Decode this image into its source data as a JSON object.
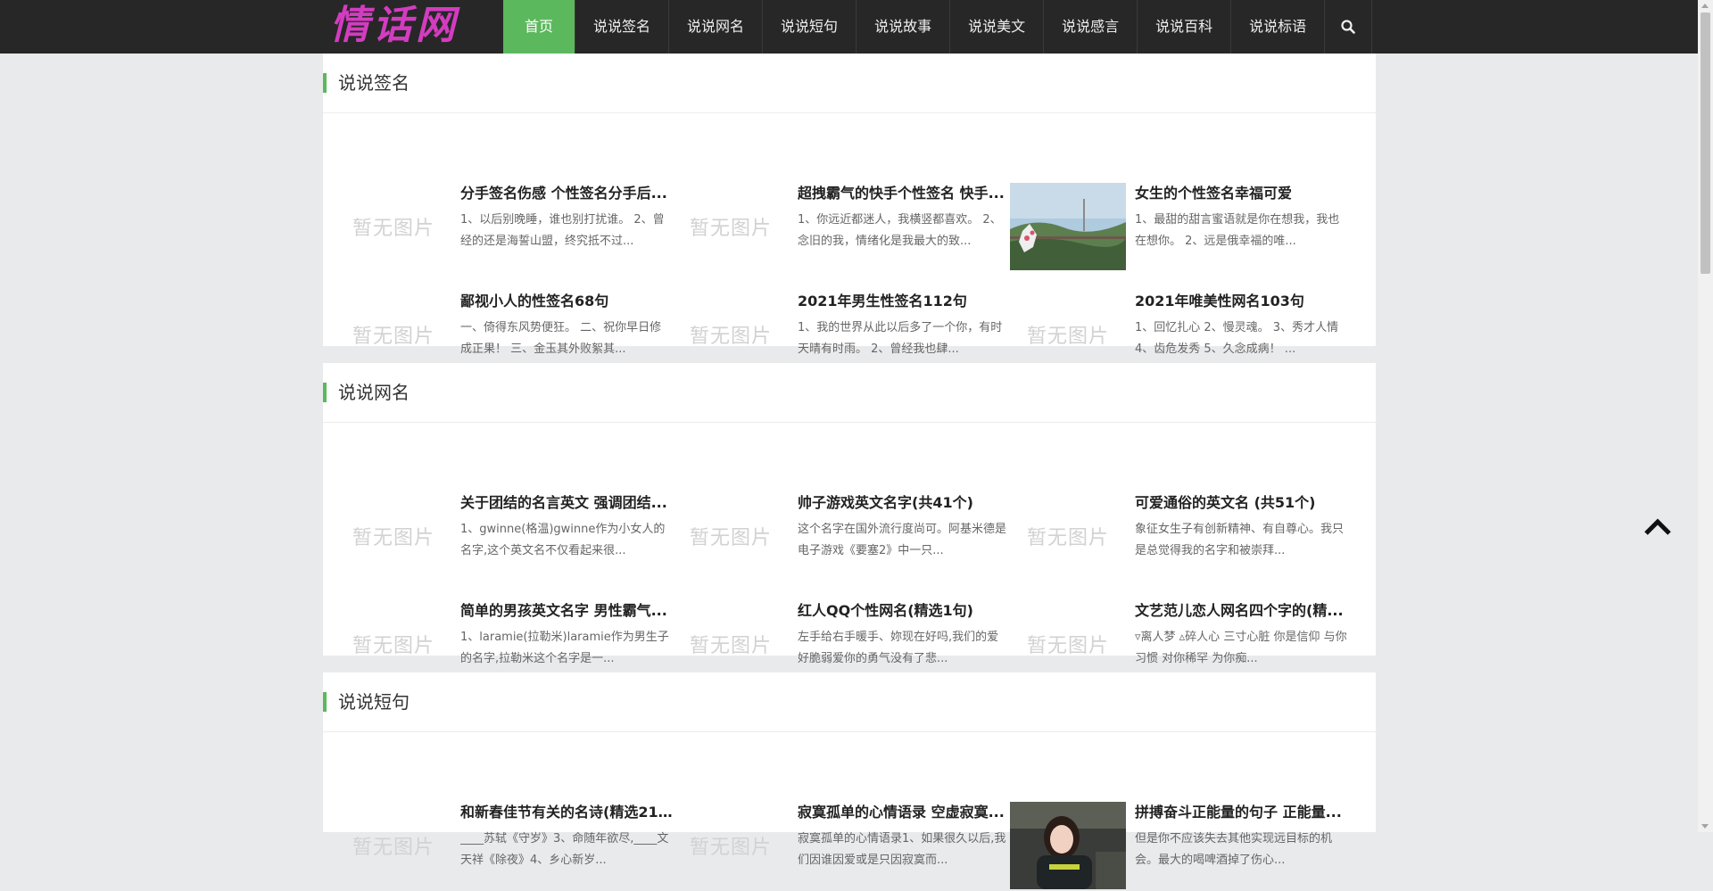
{
  "brand": {
    "logo_text": "情话网",
    "logo_color": "#d33cc0",
    "accent": "#5cb85c"
  },
  "nav": {
    "items": [
      "首页",
      "说说签名",
      "说说网名",
      "说说短句",
      "说说故事",
      "说说美文",
      "说说感言",
      "说说百科",
      "说说标语"
    ],
    "active_index": 0,
    "search_icon": "search-icon"
  },
  "placeholder_text": "暂无图片",
  "sections": [
    {
      "title": "说说签名",
      "cards": [
        {
          "title": "分手签名伤感 个性签名分手后...",
          "excerpt": "1、以后别晚睡，谁也别打扰谁。 2、曾经的还是海誓山盟，终究抵不过...",
          "image": "placeholder"
        },
        {
          "title": "超拽霸气的快手个性签名 快手...",
          "excerpt": "1、你远近都迷人，我横竖都喜欢。 2、念旧的我，情绪化是我最大的致...",
          "image": "placeholder"
        },
        {
          "title": "女生的个性签名幸福可爱",
          "excerpt": "1、最甜的甜言蜜语就是你在想我，我也在想你。 2、远是俄幸福的唯...",
          "image": "photo-tree"
        },
        {
          "title": "鄙视小人的性签名68句",
          "excerpt": "一、倚得东风势便狂。 二、祝你早日修成正果！ 三、金玉其外败絮其...",
          "image": "placeholder"
        },
        {
          "title": "2021年男生性签名112句",
          "excerpt": "1、我的世界从此以后多了一个你，有时天晴有时雨。 2、曾经我也肆...",
          "image": "placeholder"
        },
        {
          "title": "2021年唯美性网名103句",
          "excerpt": "1、回忆扎心 2、慢灵魂。 3、秀才人情 4、齿危发秀 5、久念成病！ ...",
          "image": "placeholder"
        }
      ]
    },
    {
      "title": "说说网名",
      "cards": [
        {
          "title": "关于团结的名言英文 强调团结...",
          "excerpt": "1、gwinne(格温)gwinne作为小女人的名字,这个英文名不仅看起来很...",
          "image": "placeholder"
        },
        {
          "title": "帅子游戏英文名字(共41个)",
          "excerpt": "这个名字在国外流行度尚可。阿基米德是电子游戏《要塞2》中一只...",
          "image": "placeholder"
        },
        {
          "title": "可爱通俗的英文名 (共51个)",
          "excerpt": "象征女生子有创新精神、有自尊心。我只是总觉得我的名字和被崇拜...",
          "image": "placeholder"
        },
        {
          "title": "简单的男孩英文名字 男性霸气...",
          "excerpt": "1、laramie(拉勒米)laramie作为男生子的名字,拉勒米这个名字是一...",
          "image": "placeholder"
        },
        {
          "title": "红人QQ个性网名(精选1句)",
          "excerpt": "左手给右手暖手、妳现在好吗,我们的爱好脆弱爱你的勇气没有了悲...",
          "image": "placeholder"
        },
        {
          "title": "文艺范儿恋人网名四个字的(精...",
          "excerpt": "▿离人梦 ▵碎人心 三寸心脏 你是信仰 与你习惯 对你稀罕 为你痴...",
          "image": "placeholder"
        }
      ]
    },
    {
      "title": "说说短句",
      "cards": [
        {
          "title": "和新春佳节有关的名诗(精选21...",
          "excerpt": "____苏轼《守岁》3、命随年欲尽,____文天祥《除夜》4、乡心新岁...",
          "image": "placeholder"
        },
        {
          "title": "寂寞孤单的心情语录 空虚寂寞...",
          "excerpt": "寂寞孤单的心情语录1、如果很久以后,我们因谁因爱或是只因寂寞而...",
          "image": "placeholder"
        },
        {
          "title": "拼搏奋斗正能量的句子 正能量...",
          "excerpt": "但是你不应该失去其他实现远目标的机会。最大的喝啤酒掉了伤心...",
          "image": "photo-girl"
        }
      ]
    }
  ],
  "back_to_top_icon": "chevron-up-icon"
}
